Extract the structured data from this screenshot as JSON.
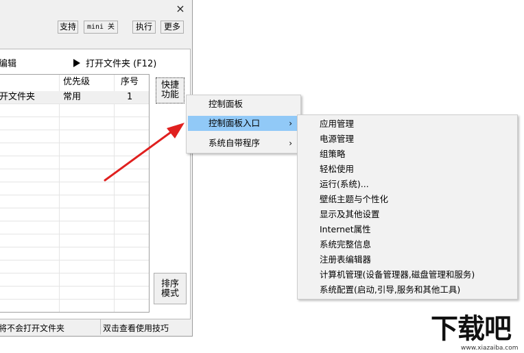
{
  "window": {
    "close_glyph": "×",
    "toolbar": {
      "support": "支持",
      "mini": "mini 关",
      "execute": "执行",
      "more": "更多"
    },
    "edit_label": "编辑",
    "open_folder": "打开文件夹 (F12)",
    "table": {
      "headers": [
        "",
        "优先级",
        "序号"
      ],
      "rows": [
        {
          "name": "打开文件夹",
          "priority": "常用",
          "index": "1"
        }
      ]
    },
    "quick_button": "快捷\n功能",
    "sort_button": "排序\n模式",
    "status": {
      "left": "将不会打开文件夹",
      "right": "双击查看使用技巧"
    }
  },
  "menu": {
    "items": [
      {
        "label": "控制面板",
        "submenu": false
      },
      {
        "label": "控制面板入口",
        "submenu": true,
        "highlighted": true
      },
      {
        "label": "系统自带程序",
        "submenu": true
      }
    ],
    "arrow": "›"
  },
  "submenu": {
    "items": [
      "应用管理",
      "电源管理",
      "组策略",
      "轻松使用",
      "运行(系统)...",
      "壁纸主题与个性化",
      "显示及其他设置",
      "Internet属性",
      "系统完整信息",
      "注册表编辑器",
      "计算机管理(设备管理器,磁盘管理和服务)",
      "系统配置(启动,引导,服务和其他工具)"
    ]
  },
  "watermark": {
    "logo": "下载吧",
    "url": "www.xiazaiba.com"
  },
  "colors": {
    "highlight": "#91c9f7",
    "arrow": "#e0201f",
    "menu_bg": "#f2f2f2"
  }
}
